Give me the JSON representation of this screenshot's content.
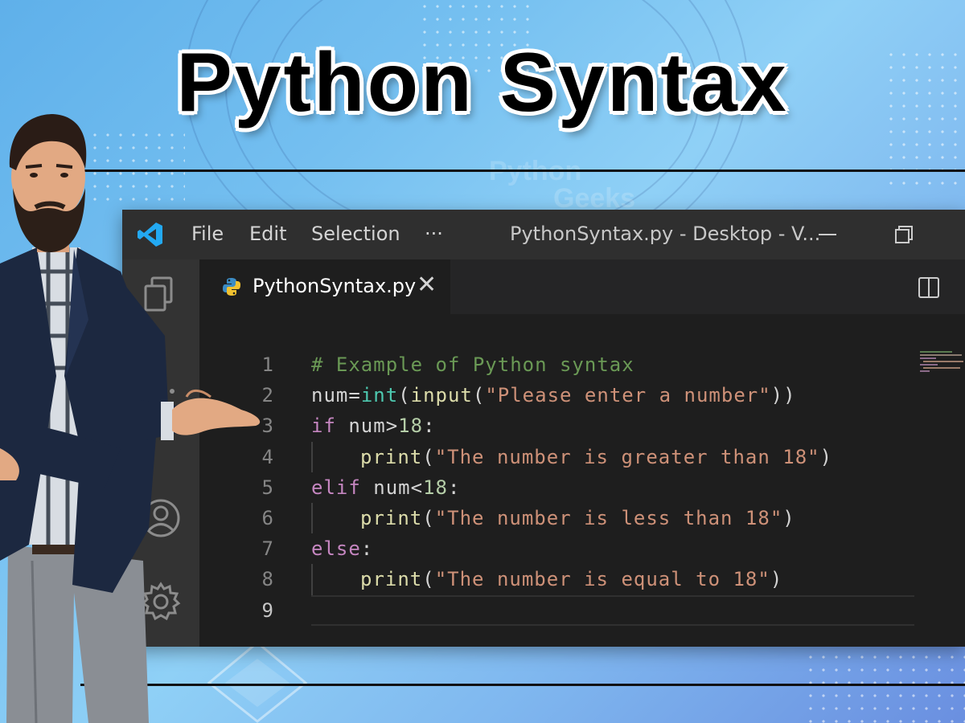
{
  "banner": {
    "title": "Python Syntax"
  },
  "watermark": {
    "line1": "Python",
    "line2": "Geeks"
  },
  "window": {
    "menu": [
      "File",
      "Edit",
      "Selection",
      "···"
    ],
    "title": "PythonSyntax.py - Desktop - V...",
    "controls": [
      "minimize-icon",
      "restore-icon"
    ]
  },
  "activity_bar": {
    "icons": [
      "explorer-icon",
      "more-icon",
      "account-icon",
      "settings-gear-icon"
    ]
  },
  "tab": {
    "filename": "PythonSyntax.py",
    "close": "✕",
    "icon": "python-icon"
  },
  "editor": {
    "line_numbers": [
      "1",
      "2",
      "3",
      "4",
      "5",
      "6",
      "7",
      "8",
      "9"
    ],
    "current_line": "9",
    "code": {
      "l1": {
        "comment": "# Example of Python syntax"
      },
      "l2": {
        "var": "num",
        "eq": "=",
        "int": "int",
        "p1": "(",
        "input": "input",
        "p2": "(",
        "str": "\"Please enter a number\"",
        "p3": "))"
      },
      "l3": {
        "kw": "if",
        "cond": " num>",
        "num": "18",
        "colon": ":"
      },
      "l4": {
        "func": "print",
        "p1": "(",
        "str": "\"The number is greater than 18\"",
        "p2": ")"
      },
      "l5": {
        "kw": "elif",
        "cond": " num<",
        "num": "18",
        "colon": ":"
      },
      "l6": {
        "func": "print",
        "p1": "(",
        "str": "\"The number is less than 18\"",
        "p2": ")"
      },
      "l7": {
        "kw": "else",
        "colon": ":"
      },
      "l8": {
        "func": "print",
        "p1": "(",
        "str": "\"The number is equal to 18\"",
        "p2": ")"
      },
      "l9": {
        "text": ""
      }
    }
  },
  "colors": {
    "comment": "#6a9955",
    "keyword": "#c586c0",
    "builtin": "#4ec9b0",
    "function": "#dcdcaa",
    "string": "#ce9178",
    "number": "#b5cea8",
    "vscode_blue": "#23a9f2"
  }
}
